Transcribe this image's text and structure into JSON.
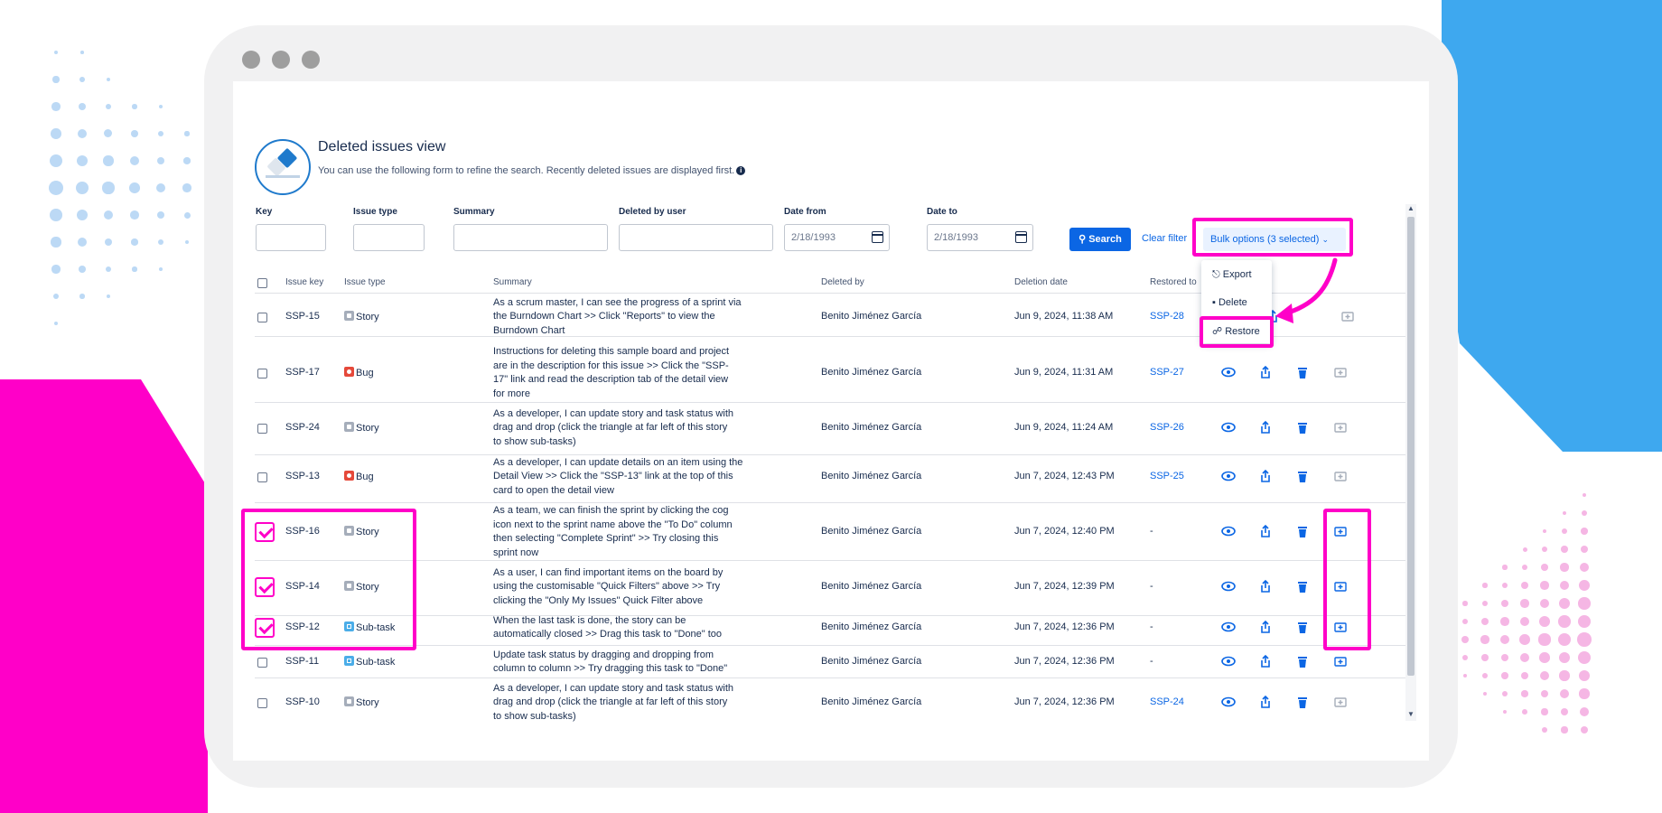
{
  "colors": {
    "accent": "#ff00c8",
    "brand_blue": "#0b66e4",
    "deco_blue": "#3ea8ef"
  },
  "page": {
    "title": "Deleted issues view",
    "subtitle": "You can use the following form to refine the search. Recently deleted issues are displayed first.",
    "info_icon": "i"
  },
  "filters": {
    "key_label": "Key",
    "type_label": "Issue type",
    "summary_label": "Summary",
    "user_label": "Deleted by user",
    "from_label": "Date from",
    "to_label": "Date to",
    "date_from": "2/18/1993",
    "date_to": "2/18/1993",
    "search": "Search",
    "clear": "Clear filter",
    "bulk": "Bulk options (3 selected)"
  },
  "menu": {
    "export": "Export",
    "delete": "Delete",
    "restore": "Restore"
  },
  "columns": {
    "key": "Issue key",
    "type": "Issue type",
    "summary": "Summary",
    "deleted_by": "Deleted by",
    "date": "Deletion date",
    "restored": "Restored to"
  },
  "rows": [
    {
      "key": "SSP-15",
      "type": "Story",
      "icon": "story",
      "summary": [
        "As a scrum master, I can see the progress of a sprint via",
        "the Burndown Chart >> Click \"Reports\" to view the",
        "Burndown Chart"
      ],
      "by": "Benito Jiménez García",
      "date": "Jun 9, 2024, 11:38 AM",
      "restored": "SSP-28",
      "checked": false
    },
    {
      "key": "SSP-17",
      "type": "Bug",
      "icon": "bug",
      "summary": [
        "Instructions for deleting this sample board and project",
        "are in the description for this issue >> Click the \"SSP-",
        "17\" link and read the description tab of the detail view",
        "for more"
      ],
      "by": "Benito Jiménez García",
      "date": "Jun 9, 2024, 11:31 AM",
      "restored": "SSP-27",
      "checked": false
    },
    {
      "key": "SSP-24",
      "type": "Story",
      "icon": "story",
      "summary": [
        "As a developer, I can update story and task status with",
        "drag and drop (click the triangle at far left of this story",
        "to show sub-tasks)"
      ],
      "by": "Benito Jiménez García",
      "date": "Jun 9, 2024, 11:24 AM",
      "restored": "SSP-26",
      "checked": false
    },
    {
      "key": "SSP-13",
      "type": "Bug",
      "icon": "bug",
      "summary": [
        "As a developer, I can update details on an item using the",
        "Detail View >> Click the \"SSP-13\" link at the top of this",
        "card to open the detail view"
      ],
      "by": "Benito Jiménez García",
      "date": "Jun 7, 2024, 12:43 PM",
      "restored": "SSP-25",
      "checked": false
    },
    {
      "key": "SSP-16",
      "type": "Story",
      "icon": "story",
      "summary": [
        "As a team, we can finish the sprint by clicking the cog",
        "icon next to the sprint name above the \"To Do\" column",
        "then selecting \"Complete Sprint\" >> Try closing this",
        "sprint now"
      ],
      "by": "Benito Jiménez García",
      "date": "Jun 7, 2024, 12:40 PM",
      "restored": "-",
      "checked": true
    },
    {
      "key": "SSP-14",
      "type": "Story",
      "icon": "story",
      "summary": [
        "As a user, I can find important items on the board by",
        "using the customisable \"Quick Filters\" above >> Try",
        "clicking the \"Only My Issues\" Quick Filter above"
      ],
      "by": "Benito Jiménez García",
      "date": "Jun 7, 2024, 12:39 PM",
      "restored": "-",
      "checked": true
    },
    {
      "key": "SSP-12",
      "type": "Sub-task",
      "icon": "sub",
      "summary": [
        "When the last task is done, the story can be",
        "automatically closed >> Drag this task to \"Done\" too"
      ],
      "by": "Benito Jiménez García",
      "date": "Jun 7, 2024, 12:36 PM",
      "restored": "-",
      "checked": true
    },
    {
      "key": "SSP-11",
      "type": "Sub-task",
      "icon": "sub",
      "summary": [
        "Update task status by dragging and dropping from",
        "column to column >> Try dragging this task to \"Done\""
      ],
      "by": "Benito Jiménez García",
      "date": "Jun 7, 2024, 12:36 PM",
      "restored": "-",
      "checked": false
    },
    {
      "key": "SSP-10",
      "type": "Story",
      "icon": "story",
      "summary": [
        "As a developer, I can update story and task status with",
        "drag and drop (click the triangle at far left of this story",
        "to show sub-tasks)"
      ],
      "by": "Benito Jiménez García",
      "date": "Jun 7, 2024, 12:36 PM",
      "restored": "SSP-24",
      "checked": false
    }
  ]
}
